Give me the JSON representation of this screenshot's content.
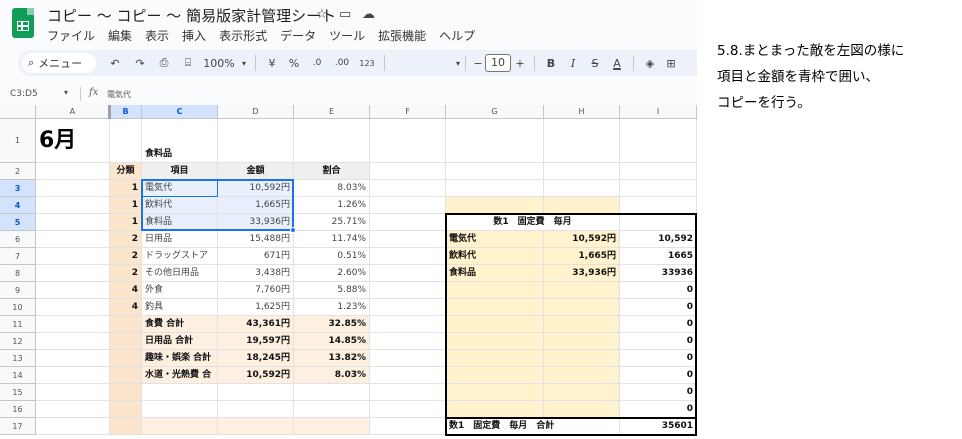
{
  "title_bar": {
    "doc_title": "コピー ～ コピー ～ 簡易版家計管理シート",
    "star_icon": "star-icon",
    "move_icon": "folder-move-icon",
    "cloud_icon": "cloud-saved-icon"
  },
  "menu": [
    "ファイル",
    "編集",
    "表示",
    "挿入",
    "表示形式",
    "データ",
    "ツール",
    "拡張機能",
    "ヘルプ"
  ],
  "toolbar": {
    "search_label": "メニュー",
    "zoom": "100%",
    "currency": "¥",
    "percent": "%",
    "dec_decrease": ".0",
    "dec_increase": ".00",
    "number_format": "123",
    "font_size": "10",
    "bold": "B",
    "italic": "I",
    "strike": "S",
    "text_color": "A"
  },
  "formula_bar": {
    "name_box": "C3:D5",
    "fx": "fx",
    "content": "電気代"
  },
  "columns": [
    "A",
    "B",
    "C",
    "D",
    "E",
    "F",
    "G",
    "H",
    "I"
  ],
  "rows": [
    "1",
    "2",
    "3",
    "4",
    "5",
    "6",
    "7",
    "8",
    "9",
    "10",
    "11",
    "12",
    "13",
    "14",
    "15",
    "16",
    "17"
  ],
  "sheet": {
    "month": "6月",
    "section": "食料品",
    "headers": {
      "category": "分類",
      "item": "項目",
      "amount": "金額",
      "ratio": "割合"
    },
    "items": [
      {
        "category": "1",
        "item": "電気代",
        "amount": "10,592円",
        "ratio": "8.03%"
      },
      {
        "category": "1",
        "item": "飲料代",
        "amount": "1,665円",
        "ratio": "1.26%"
      },
      {
        "category": "1",
        "item": "食料品",
        "amount": "33,936円",
        "ratio": "25.71%"
      },
      {
        "category": "2",
        "item": "日用品",
        "amount": "15,488円",
        "ratio": "11.74%"
      },
      {
        "category": "2",
        "item": "ドラッグストア",
        "amount": "671円",
        "ratio": "0.51%"
      },
      {
        "category": "2",
        "item": "その他日用品",
        "amount": "3,438円",
        "ratio": "2.60%"
      },
      {
        "category": "4",
        "item": "外食",
        "amount": "7,760円",
        "ratio": "5.88%"
      },
      {
        "category": "4",
        "item": "釣具",
        "amount": "1,625円",
        "ratio": "1.23%"
      }
    ],
    "totals": [
      {
        "item": "食費 合計",
        "amount": "43,361円",
        "ratio": "32.85%"
      },
      {
        "item": "日用品 合計",
        "amount": "19,597円",
        "ratio": "14.85%"
      },
      {
        "item": "趣味・娯楽 合計",
        "amount": "18,245円",
        "ratio": "13.82%"
      },
      {
        "item": "水道・光熱費 合",
        "amount": "10,592円",
        "ratio": "8.03%"
      }
    ],
    "box": {
      "header": "数1　固定費　毎月",
      "rows": [
        {
          "item": "電気代",
          "amount": "10,592円",
          "value": "10,592"
        },
        {
          "item": "飲料代",
          "amount": "1,665円",
          "value": "1665"
        },
        {
          "item": "食料品",
          "amount": "33,936円",
          "value": "33936"
        },
        {
          "item": "",
          "amount": "",
          "value": "0"
        },
        {
          "item": "",
          "amount": "",
          "value": "0"
        },
        {
          "item": "",
          "amount": "",
          "value": "0"
        },
        {
          "item": "",
          "amount": "",
          "value": "0"
        },
        {
          "item": "",
          "amount": "",
          "value": "0"
        },
        {
          "item": "",
          "amount": "",
          "value": "0"
        },
        {
          "item": "",
          "amount": "",
          "value": "0"
        },
        {
          "item": "",
          "amount": "",
          "value": "0"
        },
        {
          "item": "",
          "amount": "",
          "value": "0"
        }
      ],
      "total_label": "数1　固定費　毎月　合計",
      "total_value": "35601"
    }
  },
  "instructions": [
    "5.8.まとまった敵を左図の様に",
    "項目と金額を青枠で囲い、",
    "コピーを行う。"
  ],
  "colors": {
    "selection": "#1a73e8",
    "header_orange": "#fce5cd",
    "box_yellow": "#fff2cc",
    "logo_green": "#0f9d58"
  }
}
